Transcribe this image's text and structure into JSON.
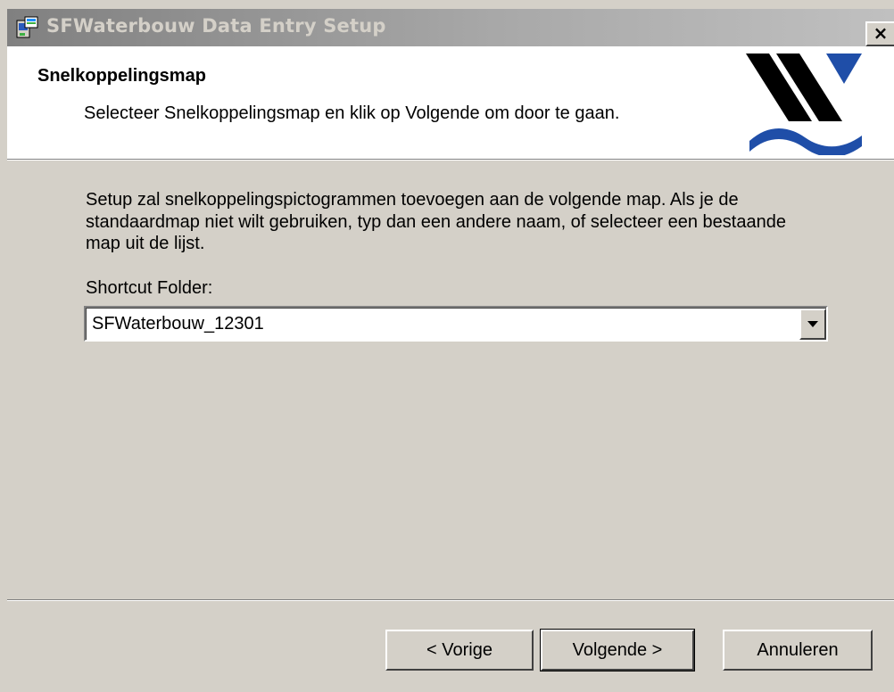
{
  "window": {
    "title": "SFWaterbouw Data Entry Setup",
    "close_label": "×"
  },
  "header": {
    "title": "Snelkoppelingsmap",
    "subtitle": "Selecteer Snelkoppelingsmap en klik op Volgende om door te gaan."
  },
  "content": {
    "description": "Setup zal snelkoppelingspictogrammen toevoegen aan de volgende map. Als je de standaardmap niet wilt gebruiken, typ dan een andere naam, of selecteer een bestaande map uit de lijst.",
    "folder_label": "Shortcut Folder:",
    "folder_value": "SFWaterbouw_12301"
  },
  "buttons": {
    "back": "< Vorige",
    "next": "Volgende >",
    "cancel": "Annuleren"
  },
  "colors": {
    "logo_black": "#000000",
    "logo_blue": "#1f4ea8",
    "dialog_bg": "#d4d0c8"
  },
  "icons": {
    "app": "installer-icon",
    "logo": "waterbouw-logo",
    "dropdown": "chevron-down-icon"
  }
}
